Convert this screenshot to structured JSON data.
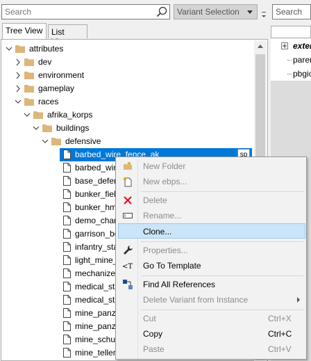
{
  "search": {
    "placeholder": "Search"
  },
  "variant_select": {
    "value": "Variant Selection"
  },
  "tabs": [
    {
      "label": "Tree View",
      "active": true
    },
    {
      "label": "List View",
      "active": false
    }
  ],
  "tree": {
    "folders": [
      {
        "label": "attributes",
        "expanded": true
      },
      {
        "label": "dev",
        "expanded": false
      },
      {
        "label": "environment",
        "expanded": false
      },
      {
        "label": "gameplay",
        "expanded": false
      },
      {
        "label": "races",
        "expanded": true
      },
      {
        "label": "afrika_korps",
        "expanded": true
      },
      {
        "label": "buildings",
        "expanded": true
      },
      {
        "label": "defensive",
        "expanded": true
      }
    ],
    "files": [
      {
        "label": "barbed_wire_fence_ak",
        "selected": true,
        "badge": "sp"
      },
      {
        "label": "barbed_wir"
      },
      {
        "label": "base_defen"
      },
      {
        "label": "bunker_fiel"
      },
      {
        "label": "bunker_hm"
      },
      {
        "label": "demo_char"
      },
      {
        "label": "garrison_bo"
      },
      {
        "label": "infantry_sta"
      },
      {
        "label": "light_mine_"
      },
      {
        "label": "mechanizec"
      },
      {
        "label": "medical_sta"
      },
      {
        "label": "medical_sta"
      },
      {
        "label": "mine_panze"
      },
      {
        "label": "mine_panze"
      },
      {
        "label": "mine_schu_"
      },
      {
        "label": "mine_teller"
      }
    ]
  },
  "right_pane": {
    "search_placeholder": "Search",
    "rows": [
      {
        "label": "exter",
        "italic_bold": true
      },
      {
        "label": "parer"
      },
      {
        "label": "pbgic"
      }
    ]
  },
  "context_menu": {
    "items": [
      {
        "label": "New Folder",
        "icon": "new-folder-icon",
        "disabled": true
      },
      {
        "label": "New ebps...",
        "icon": "new-file-icon",
        "disabled": true
      },
      {
        "label": "Delete",
        "icon": "delete-x-icon",
        "disabled": true
      },
      {
        "label": "Rename...",
        "icon": "rename-icon",
        "disabled": true
      },
      {
        "label": "Clone...",
        "icon": "",
        "disabled": false,
        "highlighted": true
      },
      {
        "label": "Properties...",
        "icon": "wrench-icon",
        "disabled": true
      },
      {
        "label": "Go To Template",
        "icon": "template-icon",
        "disabled": false
      },
      {
        "label": "Find All References",
        "icon": "references-icon",
        "disabled": false
      },
      {
        "label": "Delete Variant from Instance",
        "icon": "",
        "disabled": true,
        "submenu": true
      },
      {
        "label": "Cut",
        "shortcut": "Ctrl+X",
        "disabled": true
      },
      {
        "label": "Copy",
        "shortcut": "Ctrl+C",
        "disabled": false
      },
      {
        "label": "Paste",
        "shortcut": "Ctrl+V",
        "disabled": true
      }
    ]
  },
  "colors": {
    "selection": "#0078d7",
    "folder": "#dcb67a",
    "menu_highlight": "#cce4f7",
    "delete_red": "#e81123"
  }
}
